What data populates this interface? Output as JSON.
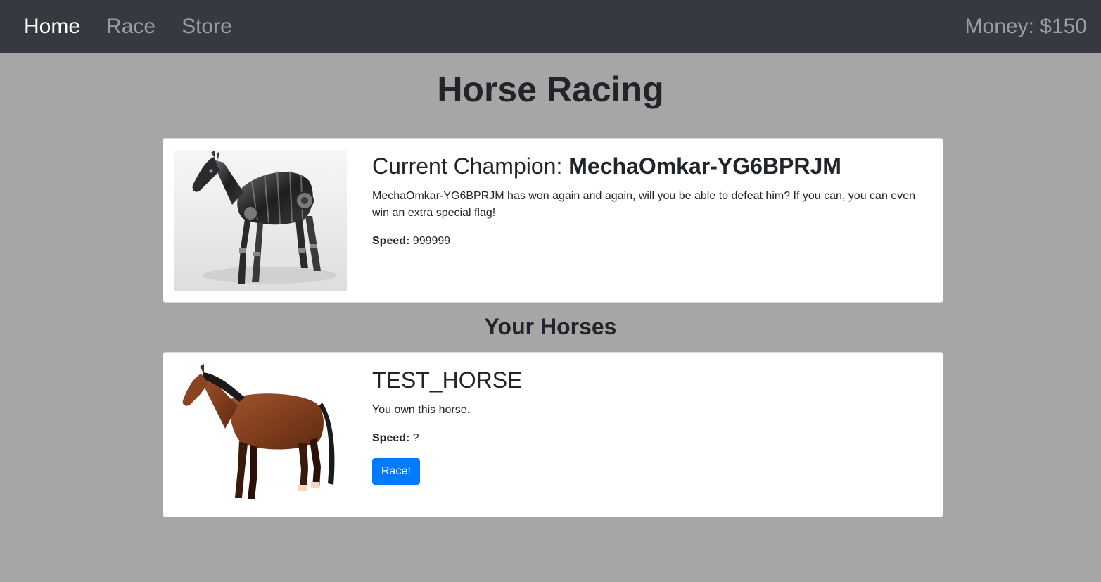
{
  "nav": {
    "items": [
      {
        "label": "Home",
        "active": true
      },
      {
        "label": "Race",
        "active": false
      },
      {
        "label": "Store",
        "active": false
      }
    ],
    "money": "Money: $150"
  },
  "page": {
    "title": "Horse Racing"
  },
  "champion": {
    "title_prefix": "Current Champion: ",
    "name": "MechaOmkar-YG6BPRJM",
    "description": "MechaOmkar-YG6BPRJM has won again and again, will you be able to defeat him? If you can, you can even win an extra special flag!",
    "speed_label": "Speed:",
    "speed_value": "999999",
    "image_icon": "robot-horse-image"
  },
  "your_horses": {
    "title": "Your Horses",
    "horses": [
      {
        "name": "TEST_HORSE",
        "status": "You own this horse.",
        "speed_label": "Speed:",
        "speed_value": "?",
        "race_button": "Race!",
        "image_icon": "brown-horse-image"
      }
    ]
  },
  "colors": {
    "navbar": "#343a40",
    "background": "#a6a6a6",
    "button": "#007bff"
  }
}
